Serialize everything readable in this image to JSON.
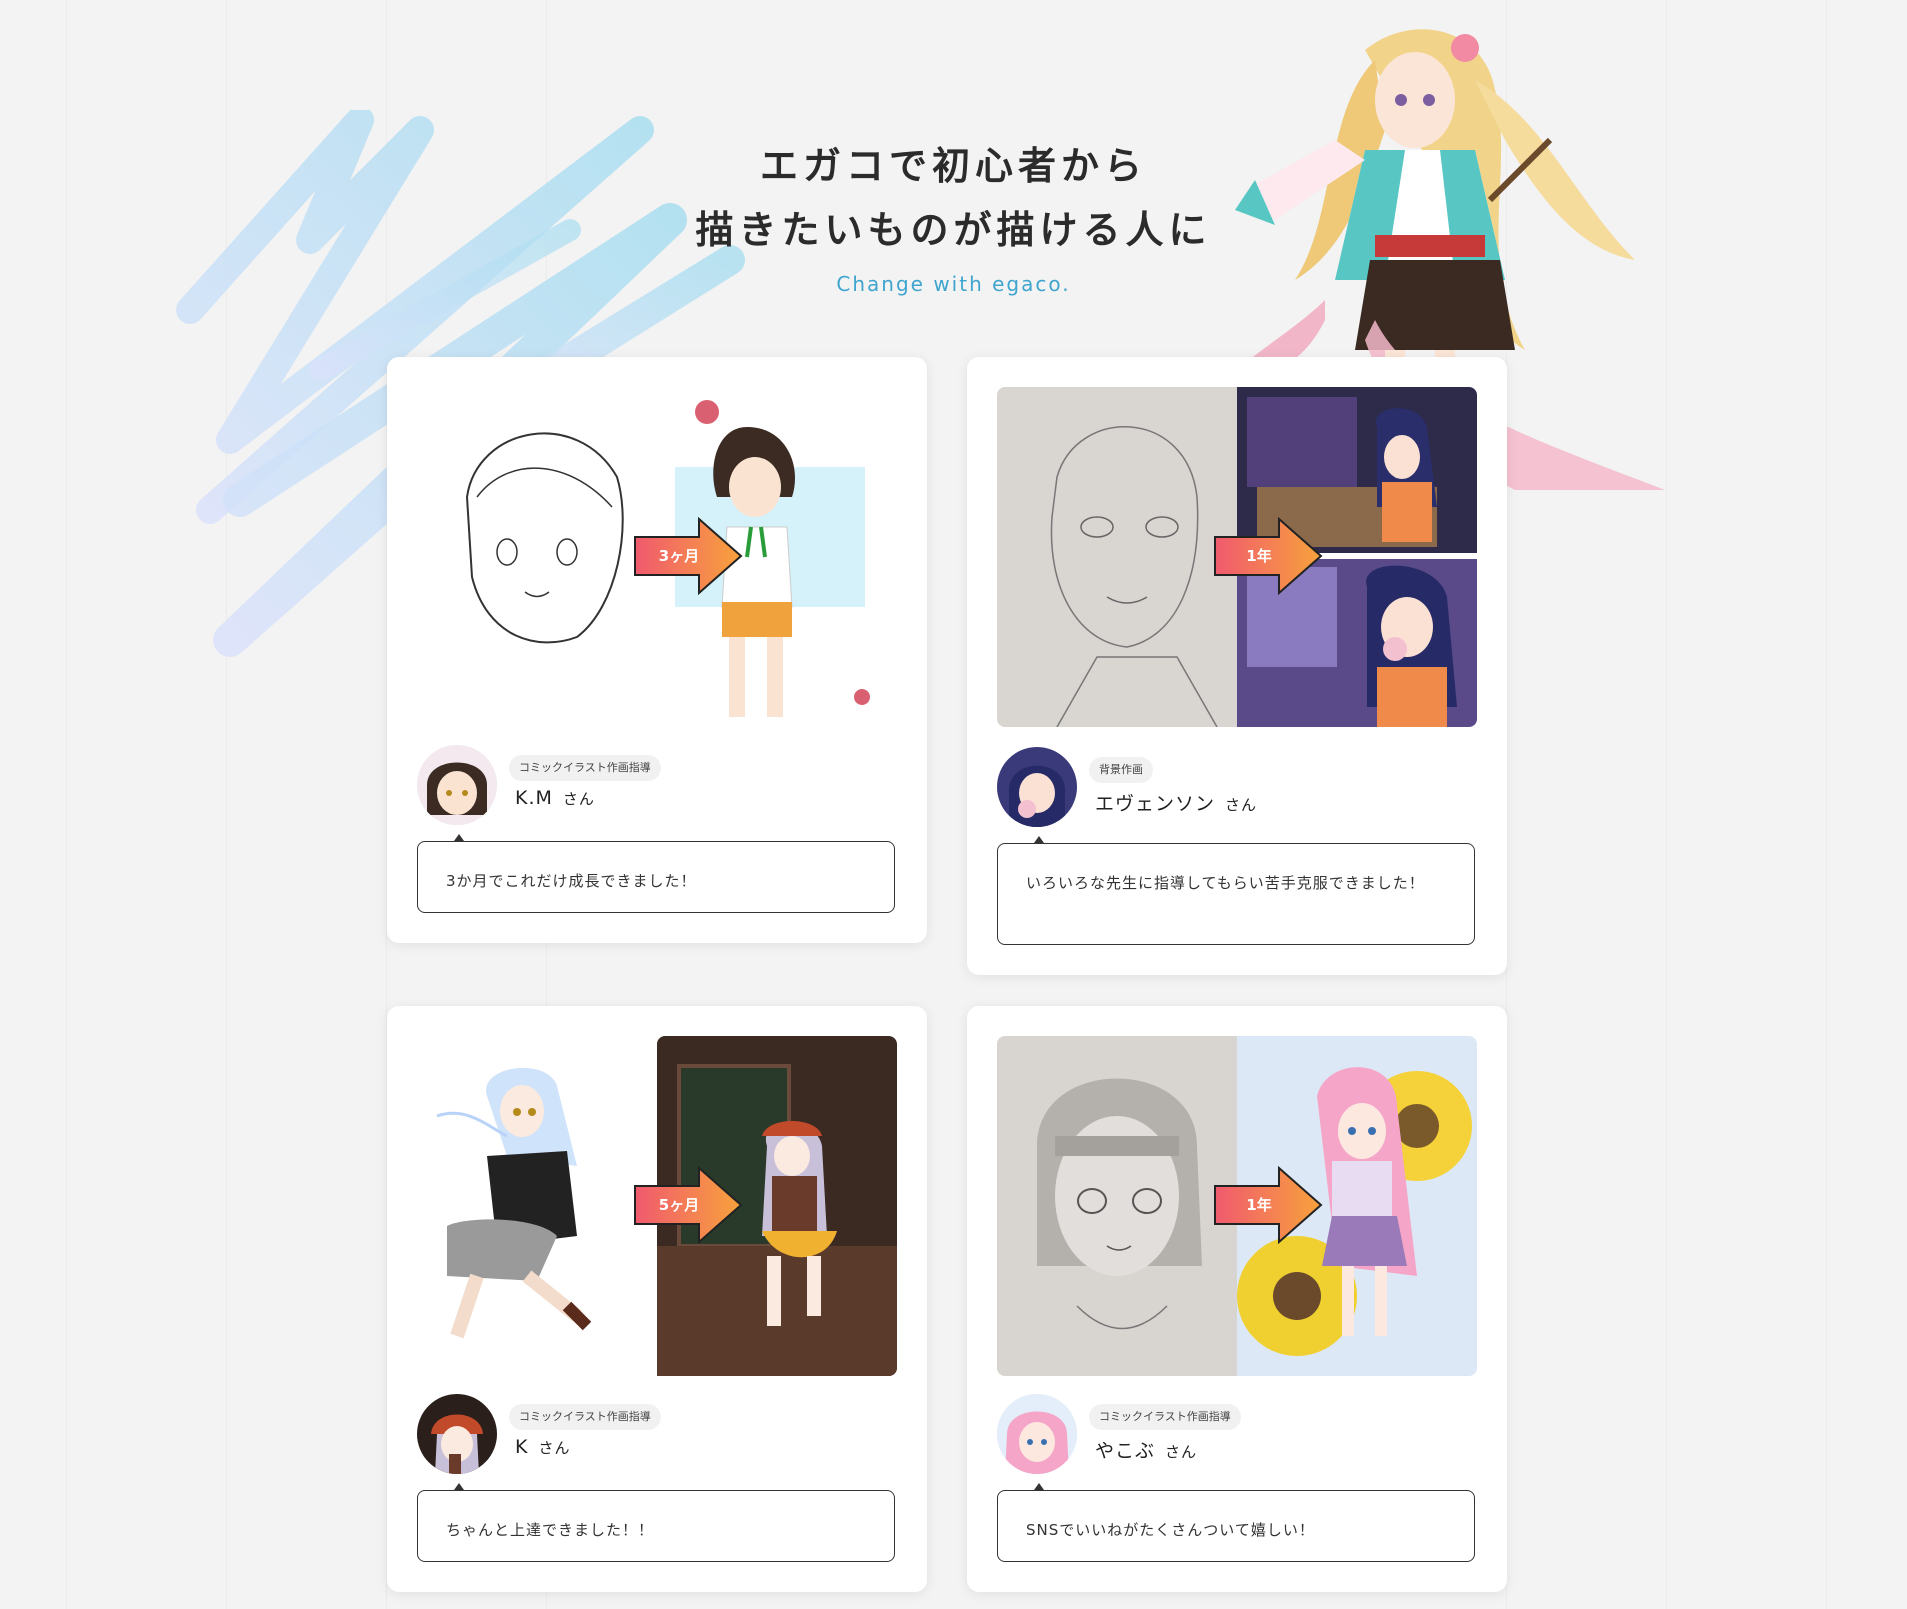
{
  "hero": {
    "title_line1": "エガコで初心者から",
    "title_line2": "描きたいものが描ける人に",
    "subtitle": "Change with egaco."
  },
  "colors": {
    "background": "#f3f3f3",
    "accent_blue": "#3fa5cf",
    "arrow_orange": "#f47b3c",
    "arrow_pink": "#f05a6e"
  },
  "cards": [
    {
      "period": "3ヶ月",
      "category": "コミックイラスト作画指導",
      "name": "K.M",
      "honorific": "さん",
      "comment": "3か月でこれだけ成長できました！"
    },
    {
      "period": "1年",
      "category": "背景作画",
      "name": "エヴェンソン",
      "honorific": "さん",
      "comment": "いろいろな先生に指導してもらい苦手克服できました！"
    },
    {
      "period": "5ヶ月",
      "category": "コミックイラスト作画指導",
      "name": "K",
      "honorific": "さん",
      "comment": "ちゃんと上達できました！！"
    },
    {
      "period": "1年",
      "category": "コミックイラスト作画指導",
      "name": "やこぶ",
      "honorific": "さん",
      "comment": "SNSでいいねがたくさんついて嬉しい！"
    }
  ]
}
